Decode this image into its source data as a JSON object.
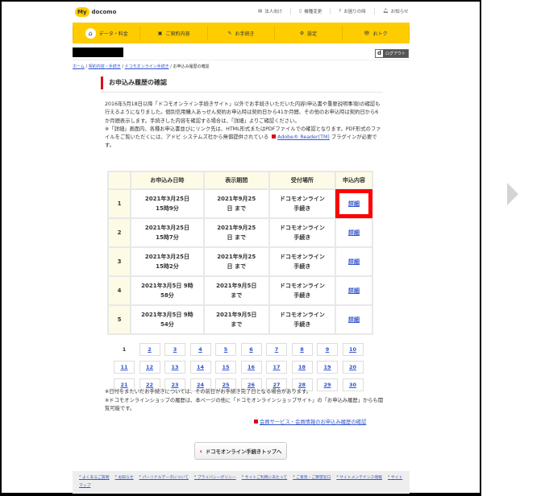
{
  "header": {
    "logo_my": "My",
    "logo_text": "docomo",
    "top_links": [
      "法人向け",
      "機種変更",
      "お困りの時",
      "お知らせ"
    ]
  },
  "gnav": [
    "データ・料金",
    "ご契約内容",
    "お手続き",
    "設定",
    "おトク"
  ],
  "logout": {
    "d": "d",
    "label": "ログアウト"
  },
  "breadcrumb": {
    "items": [
      "ホーム",
      "契約内容・手続き",
      "ドコモオンライン手続き"
    ],
    "current": "お申込み履歴の確認"
  },
  "page_title": "お申込み履歴の確認",
  "intro": {
    "p1": "2016年5月18日以降「ドコモオンライン手続きサイト」以外でお手続きいただいた内容(申込書や重要説明事項)の確認も行えるようになりました。個別信用購入あっせん契約お申込時は契約日から41か月間、その他のお申込時は契約日から6か月間表示します。手続きした内容を確認する場合は、「詳細」よりご確認ください。",
    "p2": "※「詳細」画面内、各種お申込書並びにリンク先は、HTML形式またはPDFファイルでの確認となります。PDF形式のファイルをご覧いただくには、アドビ システムズ社から無償提供されている",
    "adobe_link": "Adobe® Reader(TM)",
    "p2_end": "プラグインが必要です。"
  },
  "table": {
    "headers": [
      "",
      "お申込み日時",
      "表示期間",
      "受付場所",
      "申込内容"
    ],
    "rows": [
      {
        "no": "1",
        "date": "2021年3月25日 15時9分",
        "period": "2021年9月25日 まで",
        "place": "ドコモオンライン 手続き",
        "detail": "詳細"
      },
      {
        "no": "2",
        "date": "2021年3月25日 15時7分",
        "period": "2021年9月25日 まで",
        "place": "ドコモオンライン 手続き",
        "detail": "詳細"
      },
      {
        "no": "3",
        "date": "2021年3月25日 15時2分",
        "period": "2021年9月25日 まで",
        "place": "ドコモオンライン 手続き",
        "detail": "詳細"
      },
      {
        "no": "4",
        "date": "2021年3月5日 9時58分",
        "period": "2021年9月5日 まで",
        "place": "ドコモオンライン 手続き",
        "detail": "詳細"
      },
      {
        "no": "5",
        "date": "2021年3月5日 9時54分",
        "period": "2021年9月5日 まで",
        "place": "ドコモオンライン 手続き",
        "detail": "詳細"
      }
    ]
  },
  "pager": {
    "current": "1",
    "pages": [
      "1",
      "2",
      "3",
      "4",
      "5",
      "6",
      "7",
      "8",
      "9",
      "10",
      "11",
      "12",
      "13",
      "14",
      "15",
      "16",
      "17",
      "18",
      "19",
      "20",
      "21",
      "22",
      "23",
      "24",
      "25",
      "26",
      "27",
      "28",
      "29",
      "30"
    ]
  },
  "notes": [
    "※日付をまたいだお手続きについては、その前日がお手続き完了日となる場合があります。",
    "※ドコモオンラインショップの履歴は、本ページの他に「ドコモオンラインショップサイト」の「お申込み履歴」からも閲覧可能です。"
  ],
  "member_link": "会員サービス・会員情報のお申込み履歴の確認",
  "back_button": "ドコモオンライン手続きトップへ",
  "footer": [
    "よくあるご質問",
    "お知らせ",
    "パーソナルデータについて",
    "プライバシーポリシー",
    "サイトご利用にあたって",
    "ご意見・ご要望窓口",
    "サイトメンテナンス情報",
    "サイトマップ"
  ],
  "colors": {
    "brand_yellow": "#ffcc00",
    "accent_red": "#d80c18",
    "link": "#3355cc",
    "highlight": "#ff0000"
  }
}
